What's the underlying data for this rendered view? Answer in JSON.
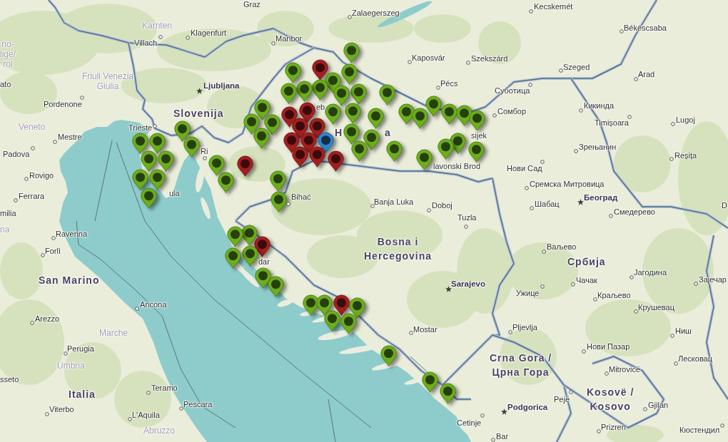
{
  "map": {
    "labels": [
      {
        "text": "Graz",
        "kind": "city"
      },
      {
        "text": "Kecskemét",
        "kind": "city"
      },
      {
        "text": "Zalaegerszeg",
        "kind": "city"
      },
      {
        "text": "Karnten",
        "kind": "region"
      },
      {
        "text": "Békéscsaba",
        "kind": "city"
      },
      {
        "text": "Klagenfurt",
        "kind": "city"
      },
      {
        "text": "Villach",
        "kind": "city"
      },
      {
        "text": "Maribor",
        "kind": "city"
      },
      {
        "text": "no-\nlige/\nrol",
        "kind": "region"
      },
      {
        "text": "Kaposvár",
        "kind": "city"
      },
      {
        "text": "Szekszárd",
        "kind": "city"
      },
      {
        "text": "Szeged",
        "kind": "city"
      },
      {
        "text": "Arad",
        "kind": "city"
      },
      {
        "text": "ato",
        "kind": "city"
      },
      {
        "text": "Friuli Venezia\nGiulia",
        "kind": "region"
      },
      {
        "text": "Ljubljana",
        "kind": "capital"
      },
      {
        "text": "Pécs",
        "kind": "city"
      },
      {
        "text": "Суботица",
        "kind": "city"
      },
      {
        "text": "Pordenone",
        "kind": "city"
      },
      {
        "text": "eb",
        "kind": "city"
      },
      {
        "text": "Кикинда",
        "kind": "city"
      },
      {
        "text": "Slovenija",
        "kind": "country"
      },
      {
        "text": "Сомбор",
        "kind": "city"
      },
      {
        "text": "Timișoara",
        "kind": "city"
      },
      {
        "text": "Lugoj",
        "kind": "city"
      },
      {
        "text": "Veneto",
        "kind": "region"
      },
      {
        "text": "Mestre",
        "kind": "city"
      },
      {
        "text": "Trieste",
        "kind": "city"
      },
      {
        "text": "H",
        "kind": "country"
      },
      {
        "text": "a",
        "kind": "country"
      },
      {
        "text": "sijek",
        "kind": "city"
      },
      {
        "text": "Зрењанин",
        "kind": "city"
      },
      {
        "text": "Padova",
        "kind": "city"
      },
      {
        "text": "Ri",
        "kind": "city"
      },
      {
        "text": "Reșița",
        "kind": "city"
      },
      {
        "text": "lavonski Brod",
        "kind": "city"
      },
      {
        "text": "Нови Сад",
        "kind": "city"
      },
      {
        "text": "Rovigo",
        "kind": "city"
      },
      {
        "text": "Сремска Митровица",
        "kind": "city"
      },
      {
        "text": "Ferrara",
        "kind": "city"
      },
      {
        "text": "ula",
        "kind": "city"
      },
      {
        "text": "Bihać",
        "kind": "city"
      },
      {
        "text": "Banja Luka",
        "kind": "city"
      },
      {
        "text": "Београд",
        "kind": "capital"
      },
      {
        "text": "Doboj",
        "kind": "city"
      },
      {
        "text": "Шабац",
        "kind": "city"
      },
      {
        "text": "D",
        "kind": "city"
      },
      {
        "text": "milia",
        "kind": "city"
      },
      {
        "text": "Tuzla",
        "kind": "city"
      },
      {
        "text": "Смедерево",
        "kind": "city"
      },
      {
        "text": "na",
        "kind": "region"
      },
      {
        "text": "Ravenna",
        "kind": "city"
      },
      {
        "text": "Forlì",
        "kind": "city"
      },
      {
        "text": "Bosna i\nHercegovina",
        "kind": "country"
      },
      {
        "text": "Ваљево",
        "kind": "city"
      },
      {
        "text": "dar",
        "kind": "city"
      },
      {
        "text": "Србија",
        "kind": "country"
      },
      {
        "text": "Јагодина",
        "kind": "city"
      },
      {
        "text": "San Marino",
        "kind": "country"
      },
      {
        "text": "Sarajevo",
        "kind": "capital"
      },
      {
        "text": "Чачак",
        "kind": "city"
      },
      {
        "text": "Зајечар",
        "kind": "city"
      },
      {
        "text": "Ужице",
        "kind": "city"
      },
      {
        "text": "Краљево",
        "kind": "city"
      },
      {
        "text": "Ancona",
        "kind": "city"
      },
      {
        "text": "Крушевац",
        "kind": "city"
      },
      {
        "text": "Arezzo",
        "kind": "city"
      },
      {
        "text": "Marche",
        "kind": "region"
      },
      {
        "text": "Mostar",
        "kind": "city"
      },
      {
        "text": "Pljevlja",
        "kind": "city"
      },
      {
        "text": "Ниш",
        "kind": "city"
      },
      {
        "text": "Perugia",
        "kind": "city"
      },
      {
        "text": "Нови Пазар",
        "kind": "city"
      },
      {
        "text": "Umbria",
        "kind": "region"
      },
      {
        "text": "Crna Gora /\nЦрна Гора",
        "kind": "country"
      },
      {
        "text": "Mitrovicë",
        "kind": "city"
      },
      {
        "text": "Лесковац",
        "kind": "city"
      },
      {
        "text": "sseto",
        "kind": "city"
      },
      {
        "text": "Viterbo",
        "kind": "city"
      },
      {
        "text": "Italia",
        "kind": "country"
      },
      {
        "text": "Teramo",
        "kind": "city"
      },
      {
        "text": "Pescara",
        "kind": "city"
      },
      {
        "text": "Podgorica",
        "kind": "capital"
      },
      {
        "text": "Pejë",
        "kind": "city"
      },
      {
        "text": "Kosovë /\nKosovo",
        "kind": "country"
      },
      {
        "text": "Gjilan",
        "kind": "city"
      },
      {
        "text": "L'Aquila",
        "kind": "city"
      },
      {
        "text": "Abruzzo",
        "kind": "region"
      },
      {
        "text": "Cetinje",
        "kind": "city"
      },
      {
        "text": "Bar",
        "kind": "city"
      },
      {
        "text": "Prizren",
        "kind": "city"
      },
      {
        "text": "Кюстендил",
        "kind": "city"
      }
    ],
    "pins": [
      {
        "color": "#6cae1c"
      },
      {
        "color": "#6cae1c"
      },
      {
        "color": "#6cae1c"
      },
      {
        "color": "#6cae1c"
      },
      {
        "color": "#6cae1c"
      },
      {
        "color": "#6cae1c"
      },
      {
        "color": "#6cae1c"
      },
      {
        "color": "#6cae1c"
      },
      {
        "color": "#6cae1c"
      },
      {
        "color": "#6cae1c"
      },
      {
        "color": "#6cae1c"
      },
      {
        "color": "#a31f1f"
      },
      {
        "color": "#6cae1c"
      },
      {
        "color": "#6cae1c"
      },
      {
        "color": "#6cae1c"
      },
      {
        "color": "#6cae1c"
      },
      {
        "color": "#6cae1c"
      },
      {
        "color": "#6cae1c"
      },
      {
        "color": "#a31f1f"
      },
      {
        "color": "#6cae1c"
      },
      {
        "color": "#6cae1c"
      },
      {
        "color": "#6cae1c"
      },
      {
        "color": "#6cae1c"
      },
      {
        "color": "#6cae1c"
      },
      {
        "color": "#6cae1c"
      },
      {
        "color": "#6cae1c"
      },
      {
        "color": "#6cae1c"
      },
      {
        "color": "#6cae1c"
      },
      {
        "color": "#6cae1c"
      },
      {
        "color": "#a31f1f"
      },
      {
        "color": "#a31f1f"
      },
      {
        "color": "#a31f1f"
      },
      {
        "color": "#a31f1f"
      },
      {
        "color": "#a31f1f"
      },
      {
        "color": "#a31f1f"
      },
      {
        "color": "#2f86cc"
      },
      {
        "color": "#a31f1f"
      },
      {
        "color": "#a31f1f"
      },
      {
        "color": "#a31f1f"
      },
      {
        "color": "#6cae1c"
      },
      {
        "color": "#6cae1c"
      },
      {
        "color": "#6cae1c"
      },
      {
        "color": "#6cae1c"
      },
      {
        "color": "#6cae1c"
      },
      {
        "color": "#6cae1c"
      },
      {
        "color": "#6cae1c"
      },
      {
        "color": "#6cae1c"
      },
      {
        "color": "#6cae1c"
      },
      {
        "color": "#6cae1c"
      },
      {
        "color": "#6cae1c"
      },
      {
        "color": "#6cae1c"
      },
      {
        "color": "#6cae1c"
      },
      {
        "color": "#6cae1c"
      },
      {
        "color": "#6cae1c"
      },
      {
        "color": "#6cae1c"
      },
      {
        "color": "#6cae1c"
      },
      {
        "color": "#6cae1c"
      },
      {
        "color": "#6cae1c"
      },
      {
        "color": "#a31f1f"
      },
      {
        "color": "#6cae1c"
      },
      {
        "color": "#6cae1c"
      },
      {
        "color": "#6cae1c"
      },
      {
        "color": "#6cae1c"
      },
      {
        "color": "#6cae1c"
      },
      {
        "color": "#6cae1c"
      },
      {
        "color": "#a31f1f"
      },
      {
        "color": "#6cae1c"
      },
      {
        "color": "#6cae1c"
      },
      {
        "color": "#6cae1c"
      },
      {
        "color": "#6cae1c"
      },
      {
        "color": "#6cae1c"
      },
      {
        "color": "#6cae1c"
      }
    ]
  }
}
